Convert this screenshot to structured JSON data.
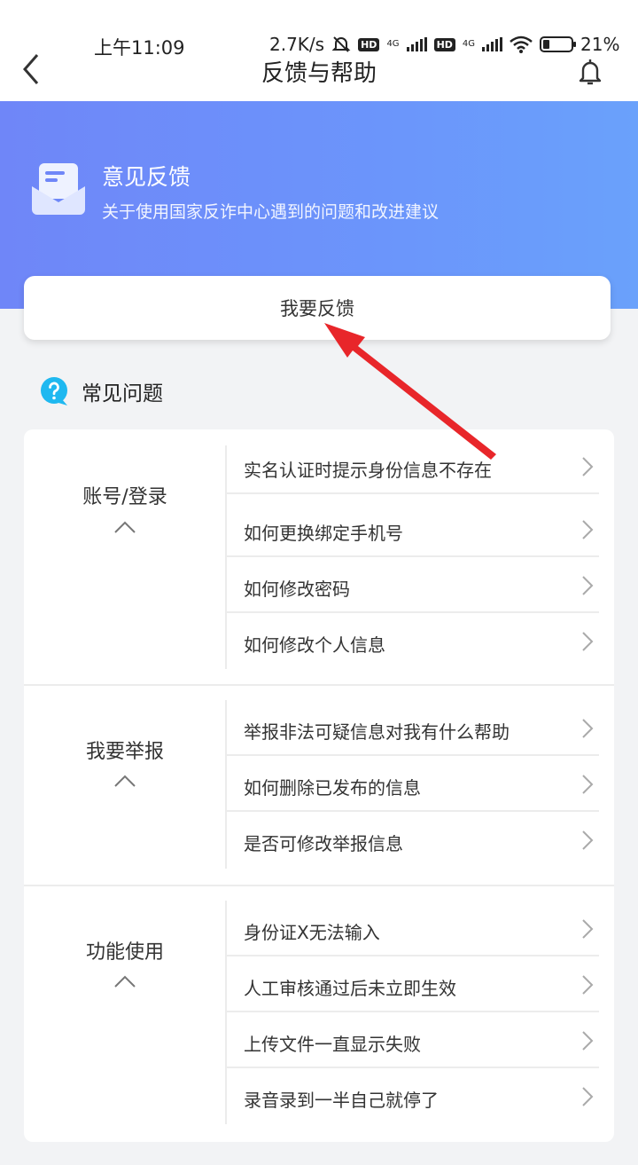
{
  "status_bar": {
    "time": "上午11:09",
    "net_speed": "2.7K/s",
    "hd1": "HD",
    "net1": "4G",
    "hd2": "HD",
    "net2": "4G",
    "battery": "21%"
  },
  "header": {
    "title": "反馈与帮助",
    "back_icon": "chevron-left-icon",
    "bell_icon": "bell-icon"
  },
  "hero": {
    "title": "意见反馈",
    "subtitle": "关于使用国家反诈中心遇到的问题和改进建议",
    "icon": "mail-feedback-icon"
  },
  "feedback_button": {
    "label": "我要反馈"
  },
  "faq": {
    "title": "常见问题",
    "icon": "question-bubble-icon",
    "groups": [
      {
        "label": "账号/登录",
        "questions": [
          "实名认证时提示身份信息不存在",
          "如何更换绑定手机号",
          "如何修改密码",
          "如何修改个人信息"
        ]
      },
      {
        "label": "我要举报",
        "questions": [
          "举报非法可疑信息对我有什么帮助",
          "如何删除已发布的信息",
          "是否可修改举报信息"
        ]
      },
      {
        "label": "功能使用",
        "questions": [
          "身份证X无法输入",
          "人工审核通过后未立即生效",
          "上传文件一直显示失败",
          " 录音录到一半自己就停了"
        ]
      }
    ]
  },
  "colors": {
    "hero_gradient_start": "#6f86f8",
    "hero_gradient_end": "#6aa1fb",
    "annotation_arrow": "#e8262a",
    "faq_icon": "#1fb8f0",
    "background": "#f2f3f5"
  }
}
